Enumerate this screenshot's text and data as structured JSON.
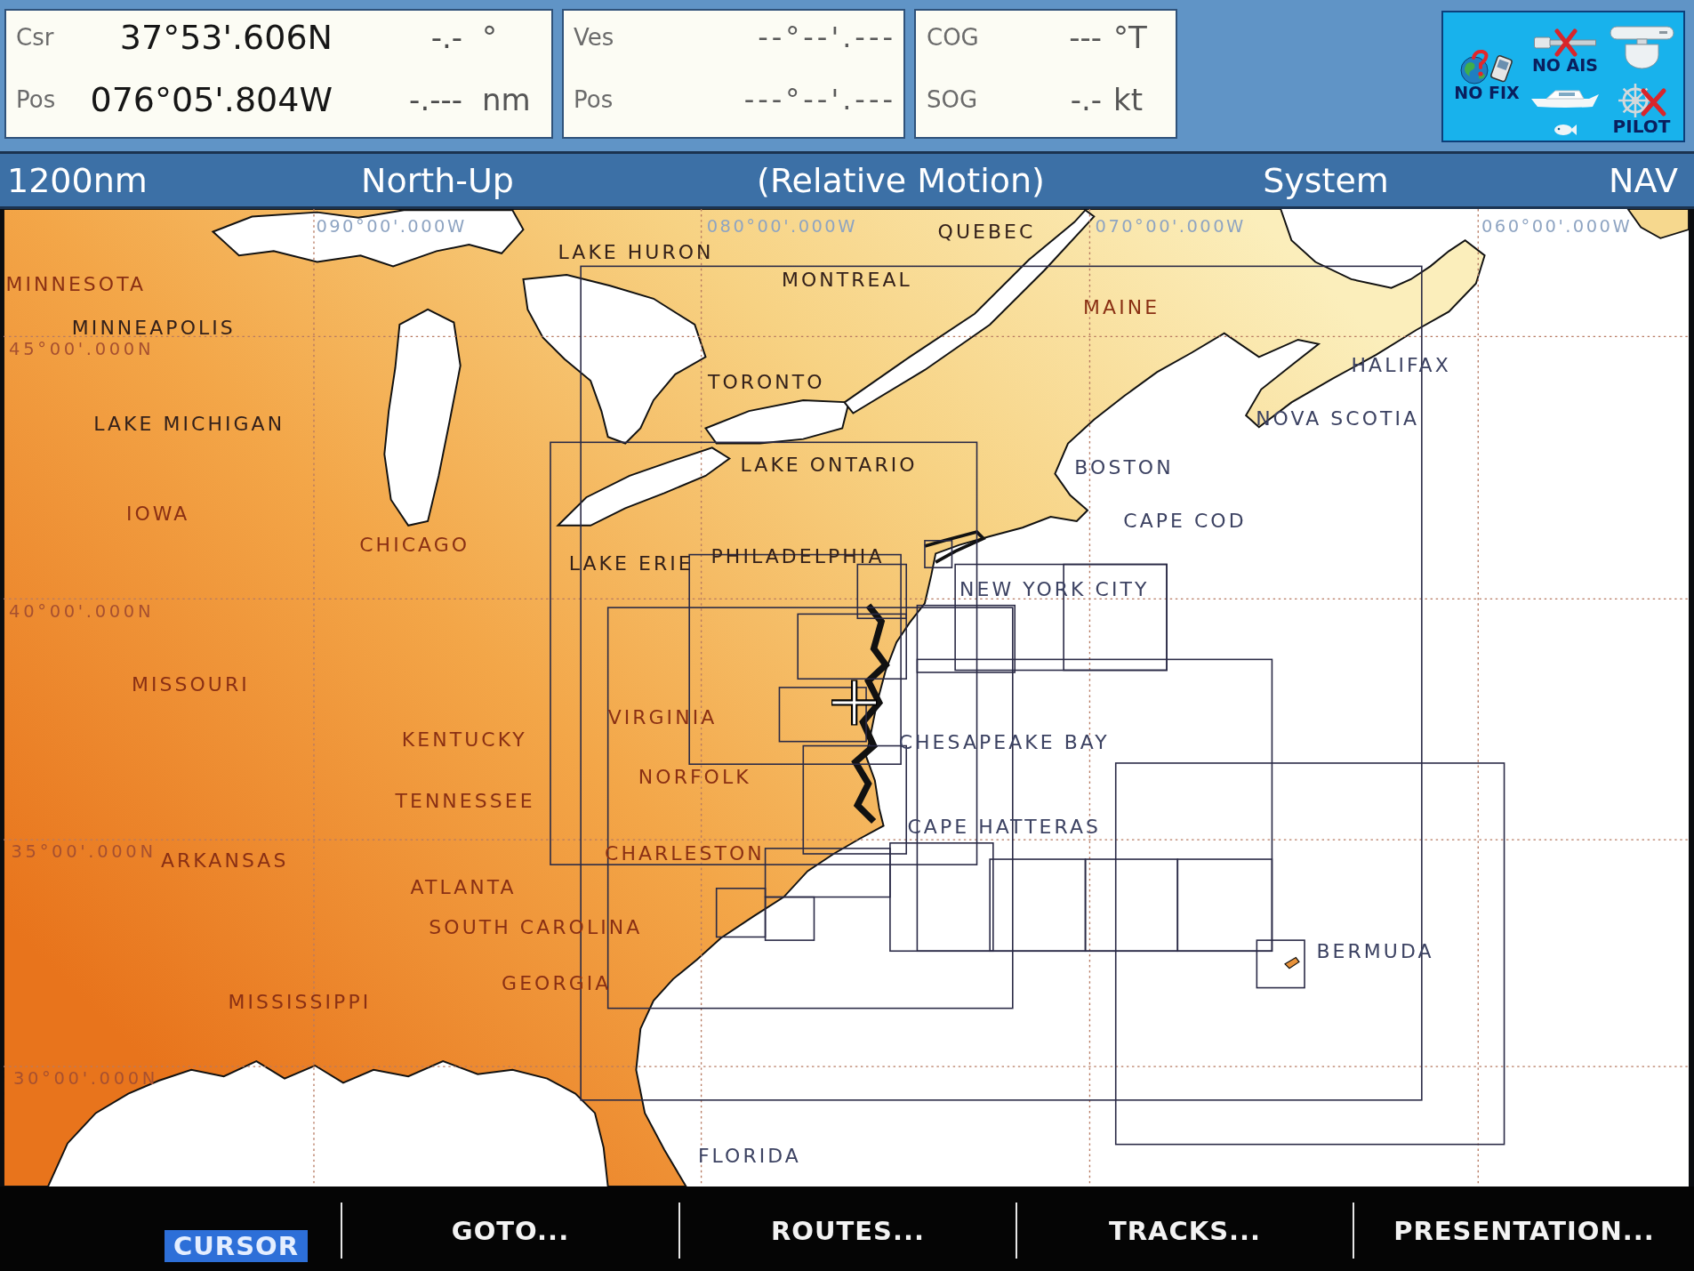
{
  "cursor_readout": {
    "rows": [
      {
        "label": "Csr",
        "value": "37°53'.606N",
        "reading": "-.-",
        "unit": "°"
      },
      {
        "label": "Pos",
        "value": "076°05'.804W",
        "reading": "-.---",
        "unit": "nm"
      }
    ]
  },
  "vessel_readout": {
    "rows": [
      {
        "label": "Ves",
        "value": "--°--'.---"
      },
      {
        "label": "Pos",
        "value": "---°--'.---"
      }
    ]
  },
  "course_readout": {
    "rows": [
      {
        "label": "COG",
        "value": "---",
        "unit": "°T"
      },
      {
        "label": "SOG",
        "value": "-.-",
        "unit": "kt"
      }
    ]
  },
  "status_panel": {
    "items": [
      {
        "kind": "gps",
        "label": "NO FIX"
      },
      {
        "kind": "ais",
        "label": "NO AIS"
      },
      {
        "kind": "autopilot",
        "label": "PILOT"
      }
    ]
  },
  "chart_header": {
    "range": "1200nm",
    "orientation": "North-Up",
    "motion": "(Relative Motion)",
    "datum": "System",
    "mode": "NAV"
  },
  "chart": {
    "longitude_labels": [
      "090°00'.000W",
      "080°00'.000W",
      "070°00'.000W",
      "060°00'.000W"
    ],
    "latitude_labels": [
      "45°00'.000N",
      "40°00'.000N",
      "35°00'.000N",
      "30°00'.000N"
    ],
    "place_labels": [
      "QUEBEC",
      "LAKE HURON",
      "MINNESOTA",
      "MONTREAL",
      "MAINE",
      "MINNEAPOLIS",
      "HALIFAX",
      "TORONTO",
      "LAKE MICHIGAN",
      "NOVA SCOTIA",
      "LAKE ONTARIO",
      "BOSTON",
      "IOWA",
      "CAPE COD",
      "CHICAGO",
      "LAKE ERIE",
      "PHILADELPHIA",
      "NEW YORK CITY",
      "MISSOURI",
      "VIRGINIA",
      "KENTUCKY",
      "CHESAPEAKE BAY",
      "NORFOLK",
      "TENNESSEE",
      "CAPE HATTERAS",
      "ARKANSAS",
      "CHARLESTON",
      "ATLANTA",
      "SOUTH CAROLINA",
      "BERMUDA",
      "GEORGIA",
      "MISSISSIPPI",
      "FLORIDA"
    ]
  },
  "softkeys": [
    {
      "label": "CURSOR",
      "selected": true
    },
    {
      "label": "GOTO...",
      "selected": false
    },
    {
      "label": "ROUTES...",
      "selected": false
    },
    {
      "label": "TRACKS...",
      "selected": false
    },
    {
      "label": "PRESENTATION...",
      "selected": false
    }
  ]
}
